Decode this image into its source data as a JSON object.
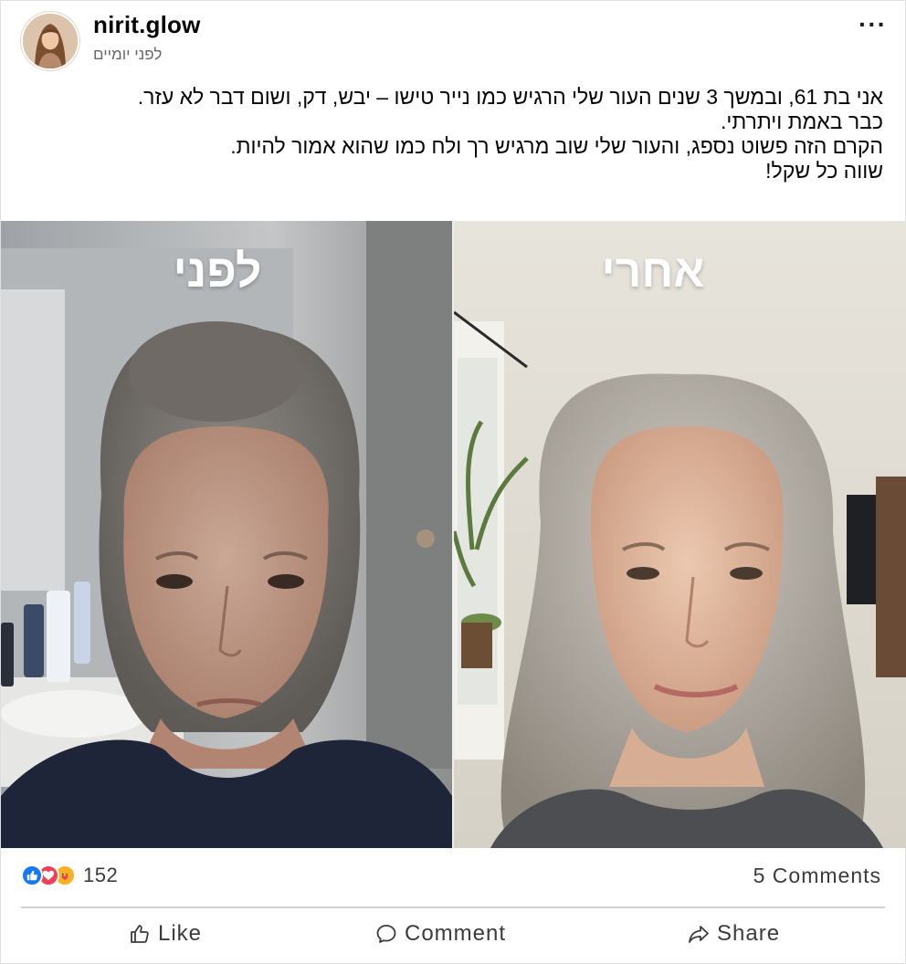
{
  "post": {
    "author": "nirit.glow",
    "timestamp": "לפני יומיים",
    "more_label": "···",
    "caption_lines": [
      "אני בת 61, ובמשך 3 שנים העור שלי הרגיש כמו נייר טישו – יבש, דק, ושום דבר לא עזר.",
      "כבר באמת ויתרתי.",
      "הקרם הזה פשוט נספג, והעור שלי שוב מרגיש רך ולח כמו שהוא אמור להיות.",
      "שווה כל שקל!"
    ],
    "image": {
      "before_label": "לפני",
      "after_label": "אחרי"
    },
    "stats": {
      "reaction_icons": [
        "like-icon",
        "love-icon",
        "care-icon"
      ],
      "reaction_count": "152",
      "comments": "5 Comments"
    },
    "actions": {
      "like": "Like",
      "comment": "Comment",
      "share": "Share"
    },
    "colors": {
      "like_blue": "#1877f2",
      "love_red": "#f33e58",
      "care_yellow": "#f7b125",
      "secondary_text": "#65676b",
      "divider": "#ced0d4"
    }
  }
}
